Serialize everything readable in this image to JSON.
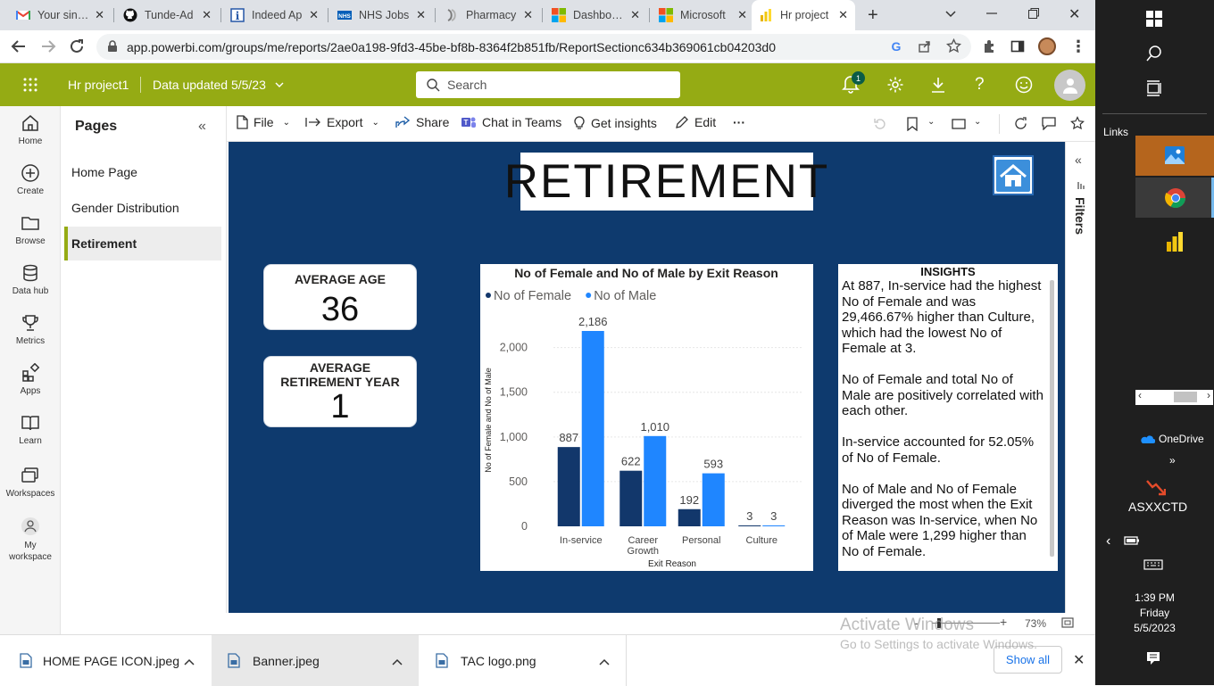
{
  "browser": {
    "tabs": [
      {
        "title": "Your single",
        "icon": "gmail-icon",
        "active": false
      },
      {
        "title": "Tunde-Ad",
        "icon": "github-icon",
        "active": false
      },
      {
        "title": "Indeed Ap",
        "icon": "indeed-icon",
        "active": false
      },
      {
        "title": "NHS Jobs",
        "icon": "nhs-icon",
        "active": false
      },
      {
        "title": "Pharmacy",
        "icon": "pharmacy-icon",
        "active": false
      },
      {
        "title": "Dashboard",
        "icon": "microsoft-icon",
        "active": false
      },
      {
        "title": "Microsoft",
        "icon": "microsoft-icon",
        "active": false
      },
      {
        "title": "Hr project",
        "icon": "powerbi-icon",
        "active": true
      }
    ],
    "new_tab": "+",
    "url": "app.powerbi.com/groups/me/reports/2ae0a198-9fd3-45be-bf8b-8364f2b851fb/ReportSectionc634b369061cb04203d0"
  },
  "pbi_header": {
    "report_name": "Hr project1",
    "data_updated": "Data updated 5/5/23",
    "search_placeholder": "Search",
    "notification_count": "1"
  },
  "left_nav": [
    {
      "label": "Home",
      "icon": "home-icon"
    },
    {
      "label": "Create",
      "icon": "plus-circle-icon"
    },
    {
      "label": "Browse",
      "icon": "folder-icon"
    },
    {
      "label": "Data hub",
      "icon": "database-icon"
    },
    {
      "label": "Metrics",
      "icon": "trophy-icon"
    },
    {
      "label": "Apps",
      "icon": "apps-icon"
    },
    {
      "label": "Learn",
      "icon": "book-icon"
    },
    {
      "label": "Workspaces",
      "icon": "workspaces-icon"
    },
    {
      "label": "My workspace",
      "icon": "person-icon"
    }
  ],
  "pages_panel": {
    "title": "Pages",
    "items": [
      {
        "label": "Home Page",
        "selected": false
      },
      {
        "label": "Gender Distribution",
        "selected": false
      },
      {
        "label": "Retirement",
        "selected": true
      }
    ]
  },
  "report_toolbar": {
    "file": "File",
    "export": "Export",
    "share": "Share",
    "chat": "Chat in Teams",
    "insights": "Get insights",
    "edit": "Edit",
    "more": "···"
  },
  "report": {
    "banner": "RETIREMENT",
    "cards": [
      {
        "label": "AVERAGE AGE",
        "value": "36"
      },
      {
        "label": "AVERAGE RETIREMENT YEAR",
        "value": "1"
      }
    ],
    "insights": {
      "title": "INSIGHTS",
      "paragraphs": [
        "At 887, In-service had the highest No of Female and was 29,466.67% higher than Culture, which had the lowest No of Female at 3.",
        "No of Female and total No of Male are positively correlated with each other.",
        "In-service accounted for 52.05% of No of Female.",
        "No of Male and No of Female diverged the most when the Exit Reason was In-service, when No of Male were 1,299 higher than No of Female."
      ]
    },
    "filters_label": "Filters"
  },
  "chart_data": {
    "type": "bar",
    "title": "No of Female and No of Male by Exit Reason",
    "categories": [
      "In-service",
      "Career Growth",
      "Personal",
      "Culture"
    ],
    "series": [
      {
        "name": "No of Female",
        "values": [
          887,
          622,
          192,
          3
        ],
        "color": "#12376b"
      },
      {
        "name": "No of Male",
        "values": [
          2186,
          1010,
          593,
          3
        ],
        "color": "#1f86ff"
      }
    ],
    "data_labels": [
      [
        "887",
        "622",
        "192",
        "3"
      ],
      [
        "2,186",
        "1,010",
        "593",
        "3"
      ]
    ],
    "xlabel": "Exit Reason",
    "ylabel": "No of Female and No of Male",
    "ylim": [
      0,
      2186
    ],
    "yticks": [
      0,
      500,
      1000,
      1500,
      2000
    ],
    "ytick_labels": [
      "0",
      "500",
      "1,000",
      "1,500",
      "2,000"
    ],
    "grid": true,
    "legend": "top-left"
  },
  "status_bar": {
    "zoom": "73%",
    "zoom_minus": "-",
    "zoom_plus": "+"
  },
  "watermark": {
    "line1": "Activate Windows",
    "line2": "Go to Settings to activate Windows."
  },
  "downloads": {
    "items": [
      "HOME PAGE ICON.jpeg",
      "Banner.jpeg",
      "TAC logo.png"
    ],
    "show_all": "Show all"
  },
  "taskbar": {
    "links": "Links",
    "onedrive": "OneDrive",
    "stock": "ASXXCTD",
    "time": "1:39 PM",
    "day": "Friday",
    "date": "5/5/2023"
  }
}
